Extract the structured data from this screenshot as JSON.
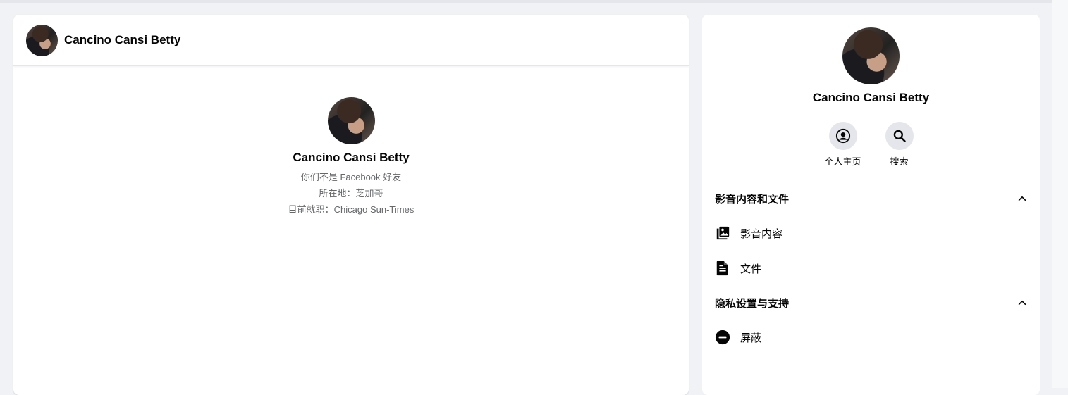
{
  "chat": {
    "header_name": "Cancino Cansi Betty",
    "intro": {
      "name": "Cancino Cansi Betty",
      "friend_status": "你们不是 Facebook 好友",
      "location": "所在地：芝加哥",
      "work": "目前就职：Chicago Sun-Times"
    }
  },
  "sidebar": {
    "name": "Cancino Cansi Betty",
    "actions": [
      {
        "label": "个人主页",
        "icon": "profile-icon"
      },
      {
        "label": "搜索",
        "icon": "search-icon"
      }
    ],
    "sections": [
      {
        "title": "影音内容和文件",
        "items": [
          {
            "label": "影音内容",
            "icon": "media-icon"
          },
          {
            "label": "文件",
            "icon": "file-icon"
          }
        ]
      },
      {
        "title": "隐私设置与支持",
        "items": [
          {
            "label": "屏蔽",
            "icon": "block-icon"
          }
        ]
      }
    ]
  }
}
